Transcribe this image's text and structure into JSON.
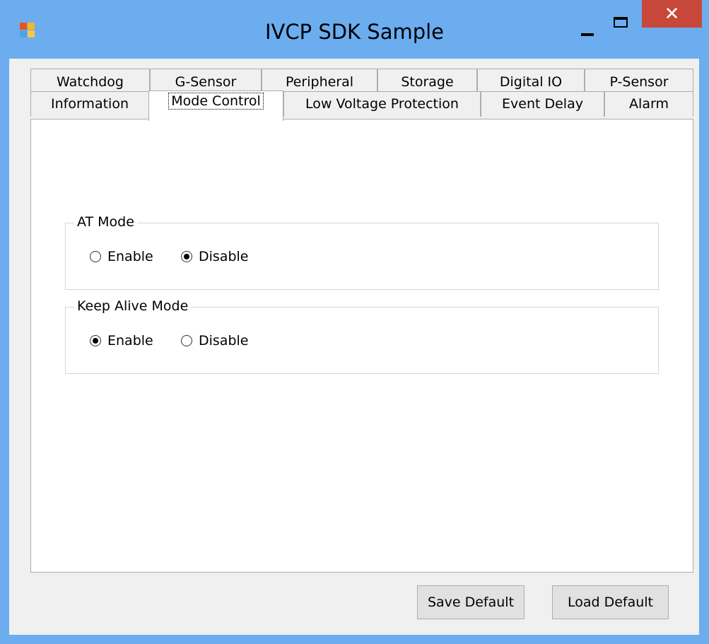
{
  "window": {
    "title": "IVCP SDK Sample",
    "close_glyph": "✕",
    "icon": "app-icon"
  },
  "tabs_row1": [
    {
      "label": "Watchdog"
    },
    {
      "label": "G-Sensor"
    },
    {
      "label": "Peripheral"
    },
    {
      "label": "Storage"
    },
    {
      "label": "Digital IO"
    },
    {
      "label": "P-Sensor"
    }
  ],
  "tabs_row2": [
    {
      "label": "Information"
    },
    {
      "label": "Mode Control",
      "active": true
    },
    {
      "label": "Low Voltage Protection"
    },
    {
      "label": "Event Delay"
    },
    {
      "label": "Alarm"
    }
  ],
  "groups": [
    {
      "title": "AT Mode",
      "options": [
        {
          "label": "Enable",
          "checked": false
        },
        {
          "label": "Disable",
          "checked": true
        }
      ]
    },
    {
      "title": "Keep Alive Mode",
      "options": [
        {
          "label": "Enable",
          "checked": true
        },
        {
          "label": "Disable",
          "checked": false
        }
      ]
    }
  ],
  "buttons": {
    "save_default": "Save Default",
    "load_default": "Load Default"
  }
}
